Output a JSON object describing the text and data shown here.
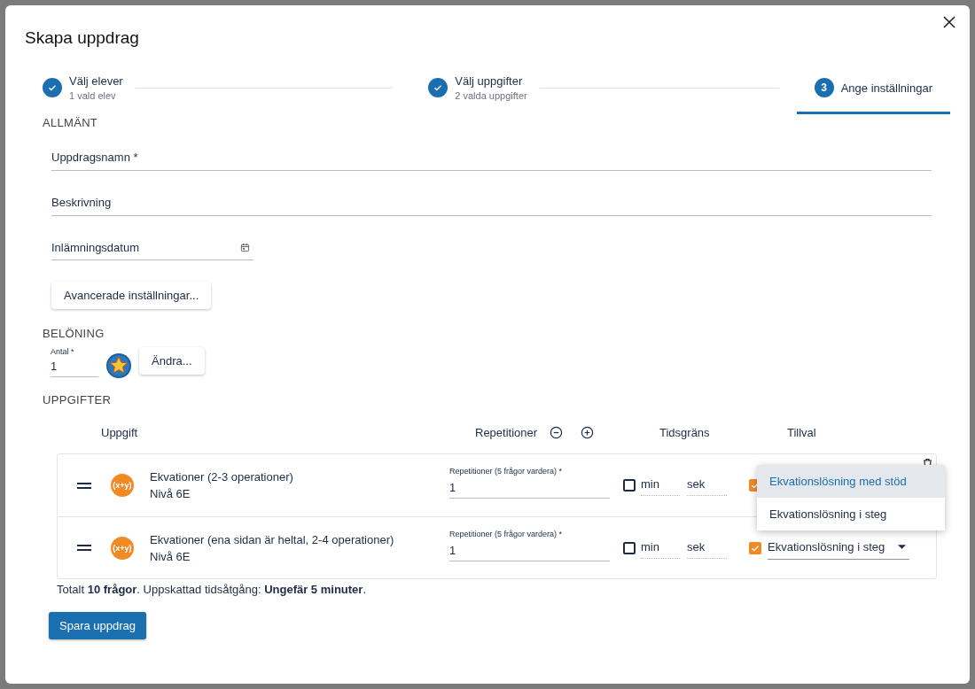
{
  "dialog": {
    "title": "Skapa uppdrag"
  },
  "steps": [
    {
      "label": "Välj elever",
      "sublabel": "1 vald elev",
      "kind": "done",
      "selected": false
    },
    {
      "label": "Välj uppgifter",
      "sublabel": "2 valda uppgifter",
      "kind": "done",
      "selected": false
    },
    {
      "label": "Ange inställningar",
      "number": "3",
      "kind": "active",
      "selected": true
    }
  ],
  "general": {
    "heading": "ALLMÄNT",
    "fields": [
      {
        "kind": "text",
        "placeholder": "Uppdragsnamn *"
      },
      {
        "kind": "text",
        "placeholder": "Beskrivning"
      },
      {
        "kind": "date",
        "placeholder": "Inlämningsdatum"
      }
    ],
    "advanced_button": "Avancerade inställningar..."
  },
  "reward": {
    "heading": "BELÖNING",
    "amount_label": "Antal *",
    "amount": "1",
    "change_button": "Ändra..."
  },
  "tasks": {
    "heading": "UPPGIFTER",
    "columns": [
      "Uppgift",
      "Repetitioner",
      "Tidsgräns",
      "Tillval"
    ],
    "rows": [
      {
        "icon": "(x+y)",
        "title": "Ekvationer (2-3 operationer)",
        "level": "Nivå 6E",
        "repetitions_label": "Repetitioner (5 frågor vardera) *",
        "repetitions": "1",
        "time_limit": false,
        "minutes": {
          "placeholder": "min"
        },
        "seconds": {
          "placeholder": "sek"
        },
        "option_checked": true,
        "deletable": true
      },
      {
        "icon": "(x+y)",
        "title": "Ekvationer (ena sidan är heltal, 2-4 operationer)",
        "level": "Nivå 6E",
        "repetitions_label": "Repetitioner (5 frågor vardera) *",
        "repetitions": "1",
        "time_limit": false,
        "minutes": {
          "placeholder": "min"
        },
        "seconds": {
          "placeholder": "sek"
        },
        "option_checked": true,
        "option_value": "Ekvationslösning i steg",
        "deletable": false
      }
    ],
    "menu": [
      {
        "label": "Ekvationslösning med stöd",
        "selected": true
      },
      {
        "label": "Ekvationslösning i steg",
        "selected": false
      }
    ],
    "summary": "Totalt **10 frågor**. Uppskattad tidsåtgång: **Ungefär 5 minuter**."
  },
  "save_button": "Spara uppdrag"
}
